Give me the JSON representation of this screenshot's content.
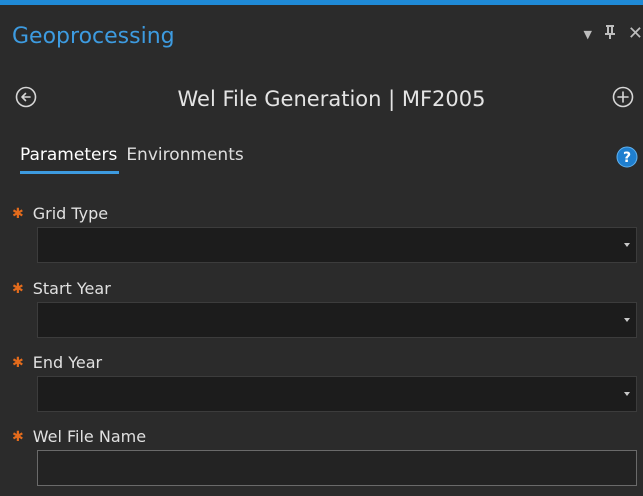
{
  "pane": {
    "title": "Geoprocessing",
    "controls": {
      "options_icon": "dropdown-arrow-icon",
      "pin_icon": "pin-icon",
      "close_icon": "close-icon",
      "pin_glyph": "᠁",
      "close_glyph": "✕",
      "arrow_glyph": "▼"
    }
  },
  "tool": {
    "title": "Wel File Generation | MF2005",
    "back_icon": "back-arrow-icon",
    "add_icon": "add-icon"
  },
  "tabs": [
    {
      "label": "Parameters",
      "active": true
    },
    {
      "label": "Environments",
      "active": false
    }
  ],
  "help_icon": "help-icon",
  "required_marker": "✱",
  "parameters": [
    {
      "label": "Grid Type",
      "type": "dropdown",
      "value": ""
    },
    {
      "label": "Start Year",
      "type": "dropdown",
      "value": ""
    },
    {
      "label": "End Year",
      "type": "dropdown",
      "value": ""
    },
    {
      "label": "Wel File Name",
      "type": "text",
      "value": ""
    }
  ],
  "colors": {
    "background": "#2b2b2b",
    "accent": "#3d9be0",
    "required": "#e36b1c",
    "field_background": "#1c1c1c"
  }
}
